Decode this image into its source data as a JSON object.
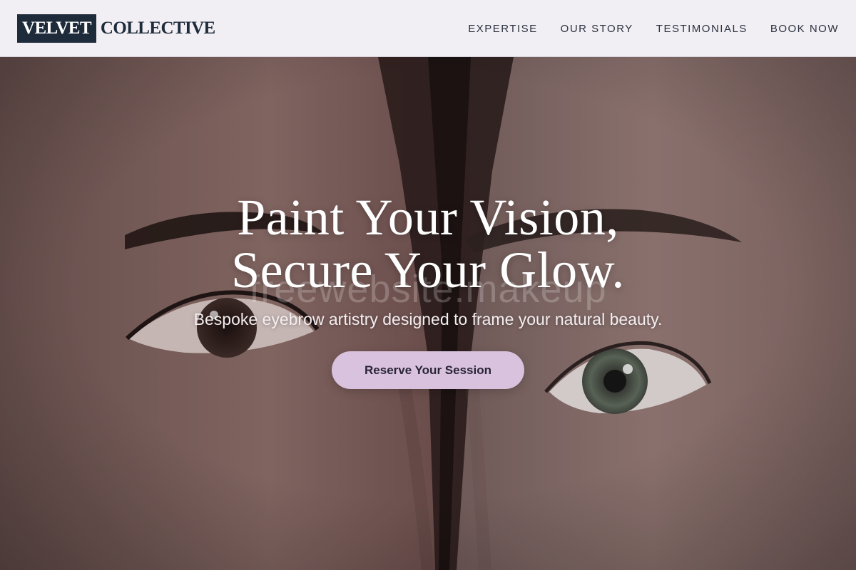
{
  "brand": {
    "logo_box_text": "VELVET",
    "logo_text": "COLLECTIVE"
  },
  "nav": {
    "items": [
      {
        "label": "EXPERTISE"
      },
      {
        "label": "OUR STORY"
      },
      {
        "label": "TESTIMONIALS"
      },
      {
        "label": "BOOK NOW"
      }
    ]
  },
  "hero": {
    "headline_line1": "Paint Your Vision,",
    "headline_line2": "Secure Your Glow.",
    "subheadline": "Bespoke eyebrow artistry designed to frame your natural beauty.",
    "cta_label": "Reserve Your Session",
    "watermark": "freewebsite.makeup"
  },
  "colors": {
    "header_bg": "#f2eff4",
    "logo_box": "#1e2b3b",
    "nav_text": "#2a3140",
    "cta_bg": "#d8c2dd",
    "cta_text": "#2a2436"
  }
}
